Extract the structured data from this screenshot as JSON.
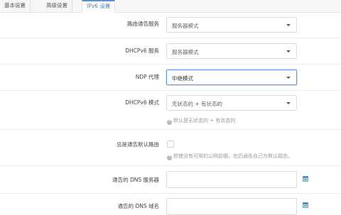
{
  "tabs": [
    {
      "label": "基本设置",
      "active": false
    },
    {
      "label": "高级设置",
      "active": false
    },
    {
      "label": "IPv6 设置",
      "active": true
    }
  ],
  "fields": {
    "router_advert": {
      "label": "路由通告服务",
      "value": "服务器模式"
    },
    "dhcpv6_service": {
      "label": "DHCPv6 服务",
      "value": "服务器模式"
    },
    "ndp_proxy": {
      "label": "NDP 代理",
      "value": "中继模式"
    },
    "dhcpv6_mode": {
      "label": "DHCPv6 模式",
      "value": "无状态的 + 有状态的",
      "hint": "默认是无状态的 + 有状态的"
    },
    "always_default_route": {
      "label": "总是通告默认路由",
      "checked": false,
      "hint": "即使没有可用的公网前缀，也仍通告自己为默认路由。"
    },
    "dns_servers": {
      "label": "通告的 DNS 服务器",
      "value": ""
    },
    "dns_domain": {
      "label": "通告的 DNS 域名",
      "value": ""
    }
  },
  "colors": {
    "accent": "#5b8fd6",
    "border": "#dcdcdc"
  },
  "icons": {
    "add": "add-entry-icon",
    "hint": "question-icon",
    "dropdown": "caret-down-icon"
  }
}
